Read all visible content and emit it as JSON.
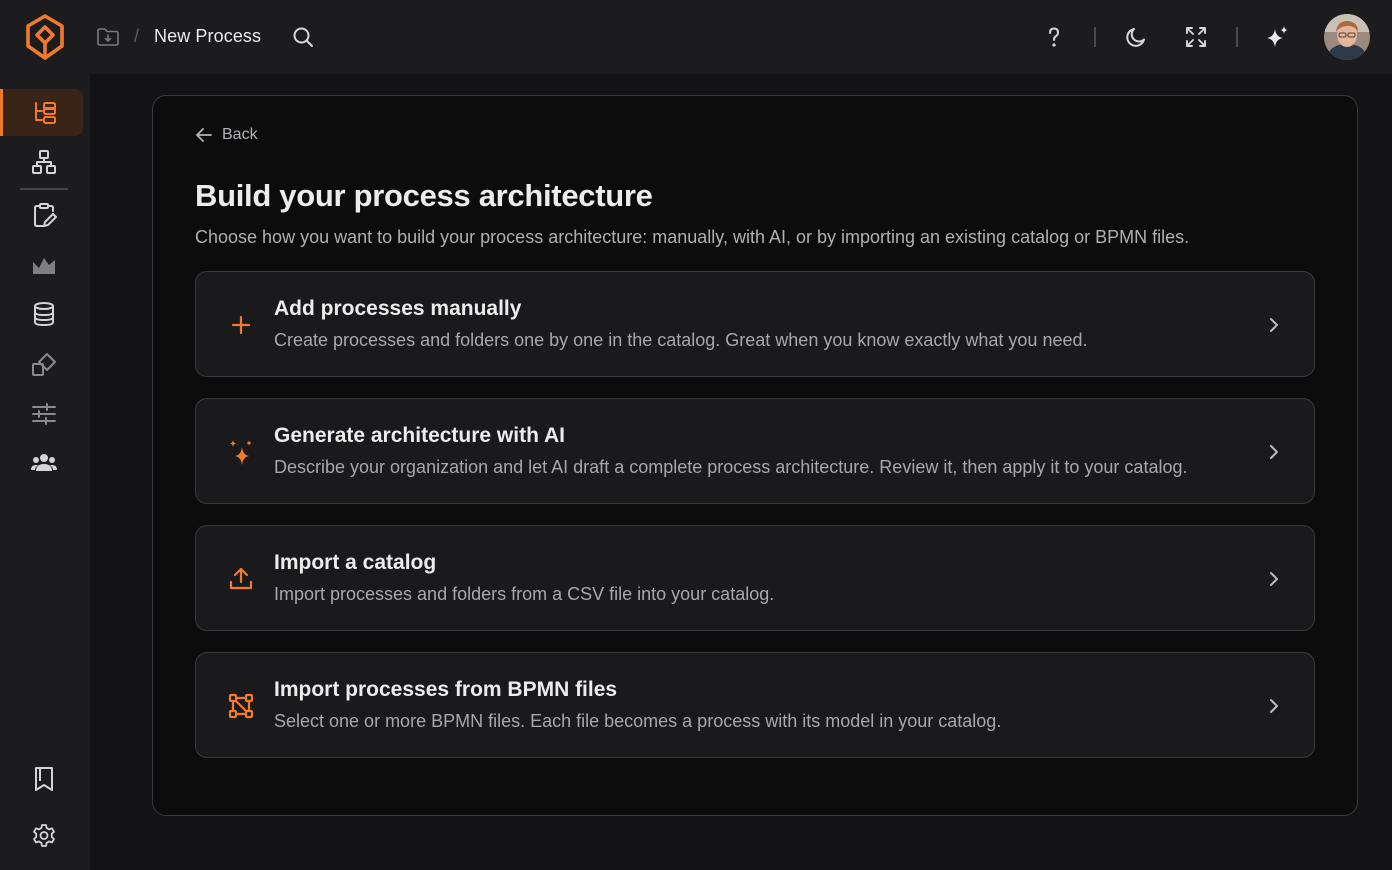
{
  "header": {
    "breadcrumb_title": "New Process",
    "separator": "/",
    "icons": [
      "folder-icon",
      "search-icon",
      "help-icon",
      "moon-icon",
      "expand-icon",
      "sparkle-icon"
    ]
  },
  "sidebar": {
    "items": [
      {
        "icon": "process-tree-icon",
        "active": true
      },
      {
        "icon": "hierarchy-icon"
      },
      {
        "icon": "clipboard-edit-icon"
      },
      {
        "icon": "landscape-icon"
      },
      {
        "icon": "database-icon"
      },
      {
        "icon": "shapes-icon"
      },
      {
        "icon": "sliders-icon"
      },
      {
        "icon": "users-icon"
      },
      {
        "icon": "bookmark-icon"
      },
      {
        "icon": "gear-icon"
      }
    ]
  },
  "page": {
    "back_label": "Back",
    "title": "Build your process architecture",
    "subtitle": "Choose how you want to build your process architecture: manually, with AI, or by importing an existing catalog or BPMN files."
  },
  "options": [
    {
      "icon": "plus-icon",
      "title": "Add processes manually",
      "description": "Create processes and folders one by one in the catalog. Great when you know exactly what you need."
    },
    {
      "icon": "sparkle-icon",
      "title": "Generate architecture with AI",
      "description": "Describe your organization and let AI draft a complete process architecture. Review it, then apply it to your catalog."
    },
    {
      "icon": "upload-icon",
      "title": "Import a catalog",
      "description": "Import processes and folders from a CSV file into your catalog."
    },
    {
      "icon": "flow-icon",
      "title": "Import processes from BPMN files",
      "description": "Select one or more BPMN files. Each file becomes a process with its model in your catalog."
    }
  ],
  "colors": {
    "accent": "#f07a2e",
    "background": "#1c1c1e",
    "card": "#0c0c0d"
  }
}
